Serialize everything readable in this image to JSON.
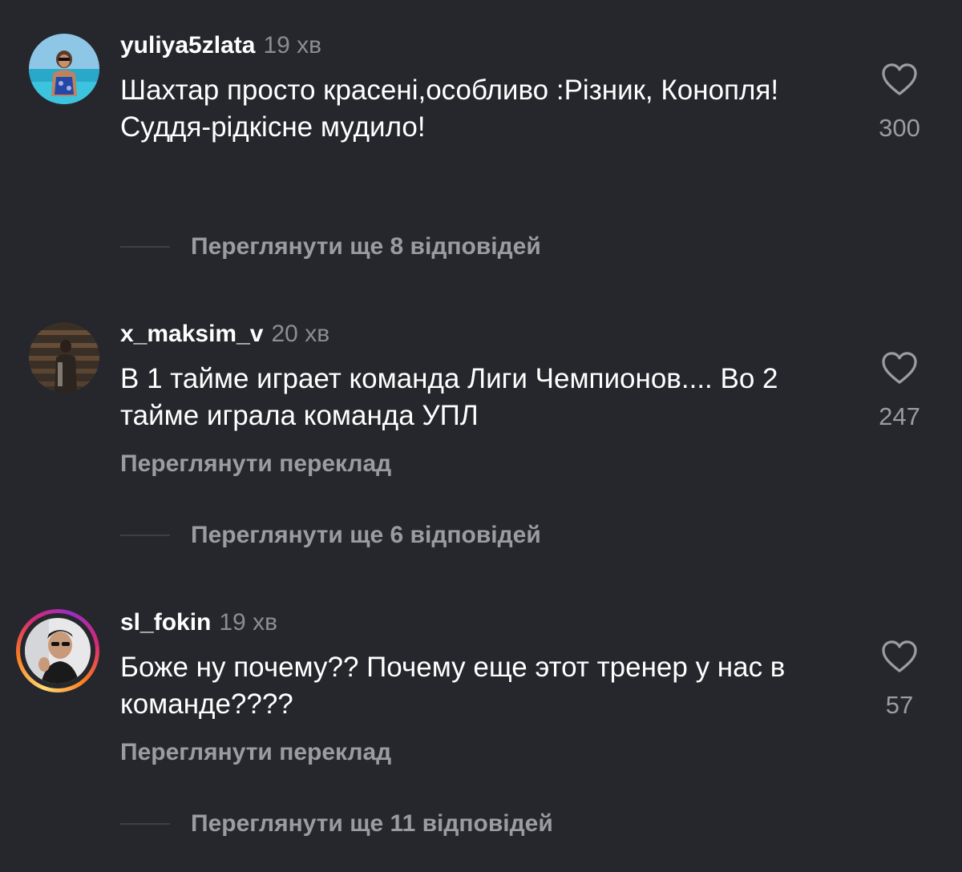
{
  "comments": [
    {
      "username": "yuliya5zlata",
      "time": "19 хв",
      "text": "Шахтар просто красені,особливо :Різник, Конопля! Суддя-рідкісне мудило!",
      "likes": "300",
      "translate_label": "",
      "replies_label": "Переглянути ще 8 відповідей"
    },
    {
      "username": "x_maksim_v",
      "time": "20 хв",
      "text": "В 1 тайме играет команда Лиги Чемпионов.... Во 2 тайме играла команда УПЛ",
      "likes": "247",
      "translate_label": "Переглянути переклад",
      "replies_label": "Переглянути ще 6 відповідей"
    },
    {
      "username": "sl_fokin",
      "time": "19 хв",
      "text": "Боже ну почему?? Почему еще этот тренер у нас в команде????",
      "likes": "57",
      "translate_label": "Переглянути переклад",
      "replies_label": "Переглянути ще 11 відповідей"
    }
  ],
  "colors": {
    "background": "#25272c",
    "text_primary": "#ffffff",
    "text_secondary": "#9a9ca2",
    "story_ring": [
      "#feda75",
      "#fa7e1e",
      "#d62976",
      "#962fbf"
    ]
  },
  "icons": {
    "like": "heart-outline-icon"
  }
}
